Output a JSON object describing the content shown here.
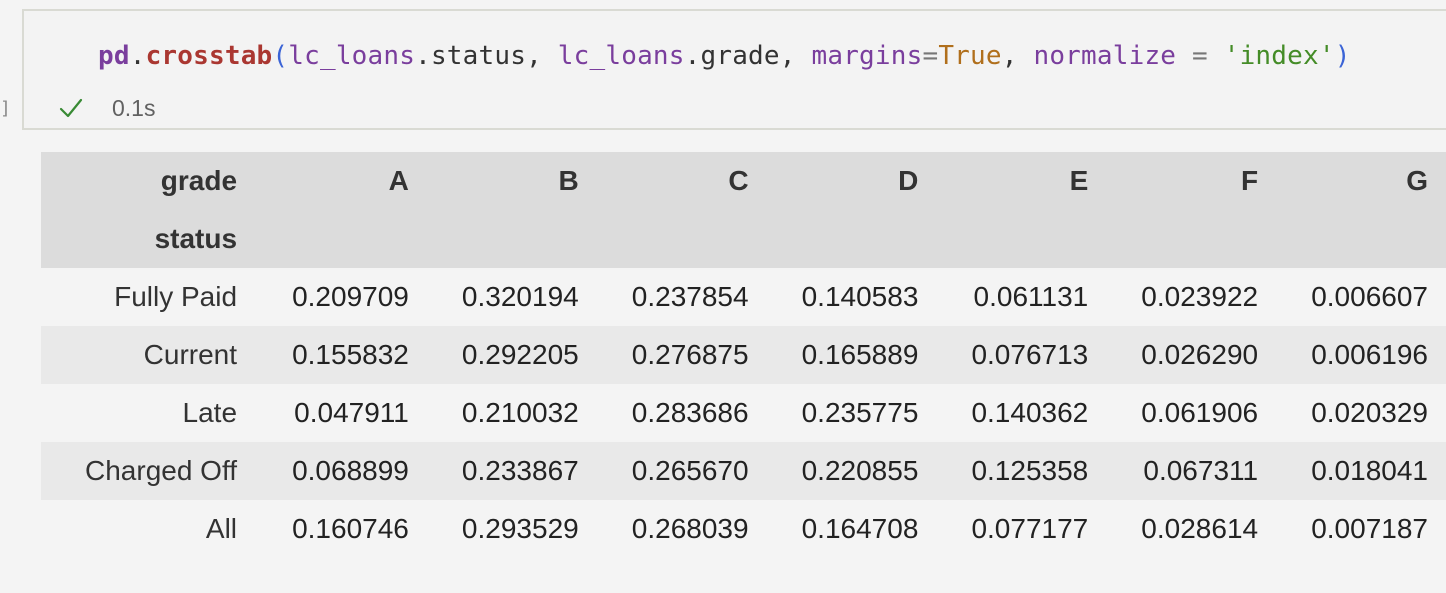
{
  "cell": {
    "marker": "]",
    "code": {
      "mod": "pd",
      "dot1": ".",
      "fn": "crosstab",
      "lparen": "(",
      "arg1_var": "lc_loans",
      "dot2": ".",
      "arg1_attr": "status",
      "comma1": ", ",
      "arg2_var": "lc_loans",
      "dot3": ".",
      "arg2_attr": "grade",
      "comma2": ", ",
      "kw1": "margins",
      "eq1": "=",
      "val1": "True",
      "comma3": ", ",
      "kw2": "normalize",
      "eq2": " = ",
      "val2": "'index'",
      "rparen": ")"
    },
    "status": {
      "icon": "checkmark-icon",
      "time": "0.1s",
      "color": "#388a34"
    }
  },
  "output": {
    "columns_label": "grade",
    "index_label": "status",
    "columns": [
      "A",
      "B",
      "C",
      "D",
      "E",
      "F",
      "G"
    ],
    "rows": [
      {
        "label": "Fully Paid",
        "values": [
          "0.209709",
          "0.320194",
          "0.237854",
          "0.140583",
          "0.061131",
          "0.023922",
          "0.006607"
        ]
      },
      {
        "label": "Current",
        "values": [
          "0.155832",
          "0.292205",
          "0.276875",
          "0.165889",
          "0.076713",
          "0.026290",
          "0.006196"
        ]
      },
      {
        "label": "Late",
        "values": [
          "0.047911",
          "0.210032",
          "0.283686",
          "0.235775",
          "0.140362",
          "0.061906",
          "0.020329"
        ]
      },
      {
        "label": "Charged Off",
        "values": [
          "0.068899",
          "0.233867",
          "0.265670",
          "0.220855",
          "0.125358",
          "0.067311",
          "0.018041"
        ]
      },
      {
        "label": "All",
        "values": [
          "0.160746",
          "0.293529",
          "0.268039",
          "0.164708",
          "0.077177",
          "0.028614",
          "0.007187"
        ]
      }
    ]
  }
}
